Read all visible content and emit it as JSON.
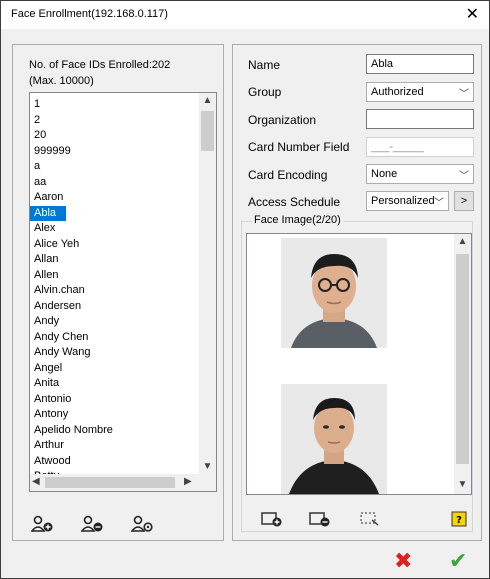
{
  "window": {
    "title": "Face Enrollment(192.168.0.117)",
    "close_glyph": "✕"
  },
  "left": {
    "enrolled_text": "No. of Face IDs Enrolled:202",
    "max_text": "(Max. 10000)",
    "items": [
      "1",
      "2",
      "20",
      "999999",
      "a",
      "aa",
      "Aaron",
      "Abla",
      "Alex",
      "Alice Yeh",
      "Allan",
      "Allen",
      "Alvin.chan",
      "Andersen",
      "Andy",
      "Andy Chen",
      "Andy Wang",
      "Angel",
      "Anita",
      "Antonio",
      "Antony",
      "Apelido Nombre",
      "Arthur",
      "Atwood",
      "Betty"
    ],
    "selected": "Abla",
    "buttons": [
      "add-user-icon",
      "remove-user-icon",
      "search-user-icon"
    ]
  },
  "form": {
    "name_label": "Name",
    "name_value": "Abla",
    "group_label": "Group",
    "group_value": "Authorized",
    "org_label": "Organization",
    "org_value": "",
    "card_label": "Card Number Field",
    "card_value": "___-_____",
    "encoding_label": "Card Encoding",
    "encoding_value": "None",
    "schedule_label": "Access Schedule",
    "schedule_value": "Personalized",
    "schedule_btn": ">",
    "face_label": "Face Image(2/20)"
  },
  "face_buttons": [
    "add-photo-icon",
    "delete-photo-icon",
    "crop-icon",
    "help-icon"
  ],
  "bottom": {
    "cancel_glyph": "✖",
    "ok_glyph": "✔",
    "cancel_color": "#e02020",
    "ok_color": "#3aa53a"
  }
}
